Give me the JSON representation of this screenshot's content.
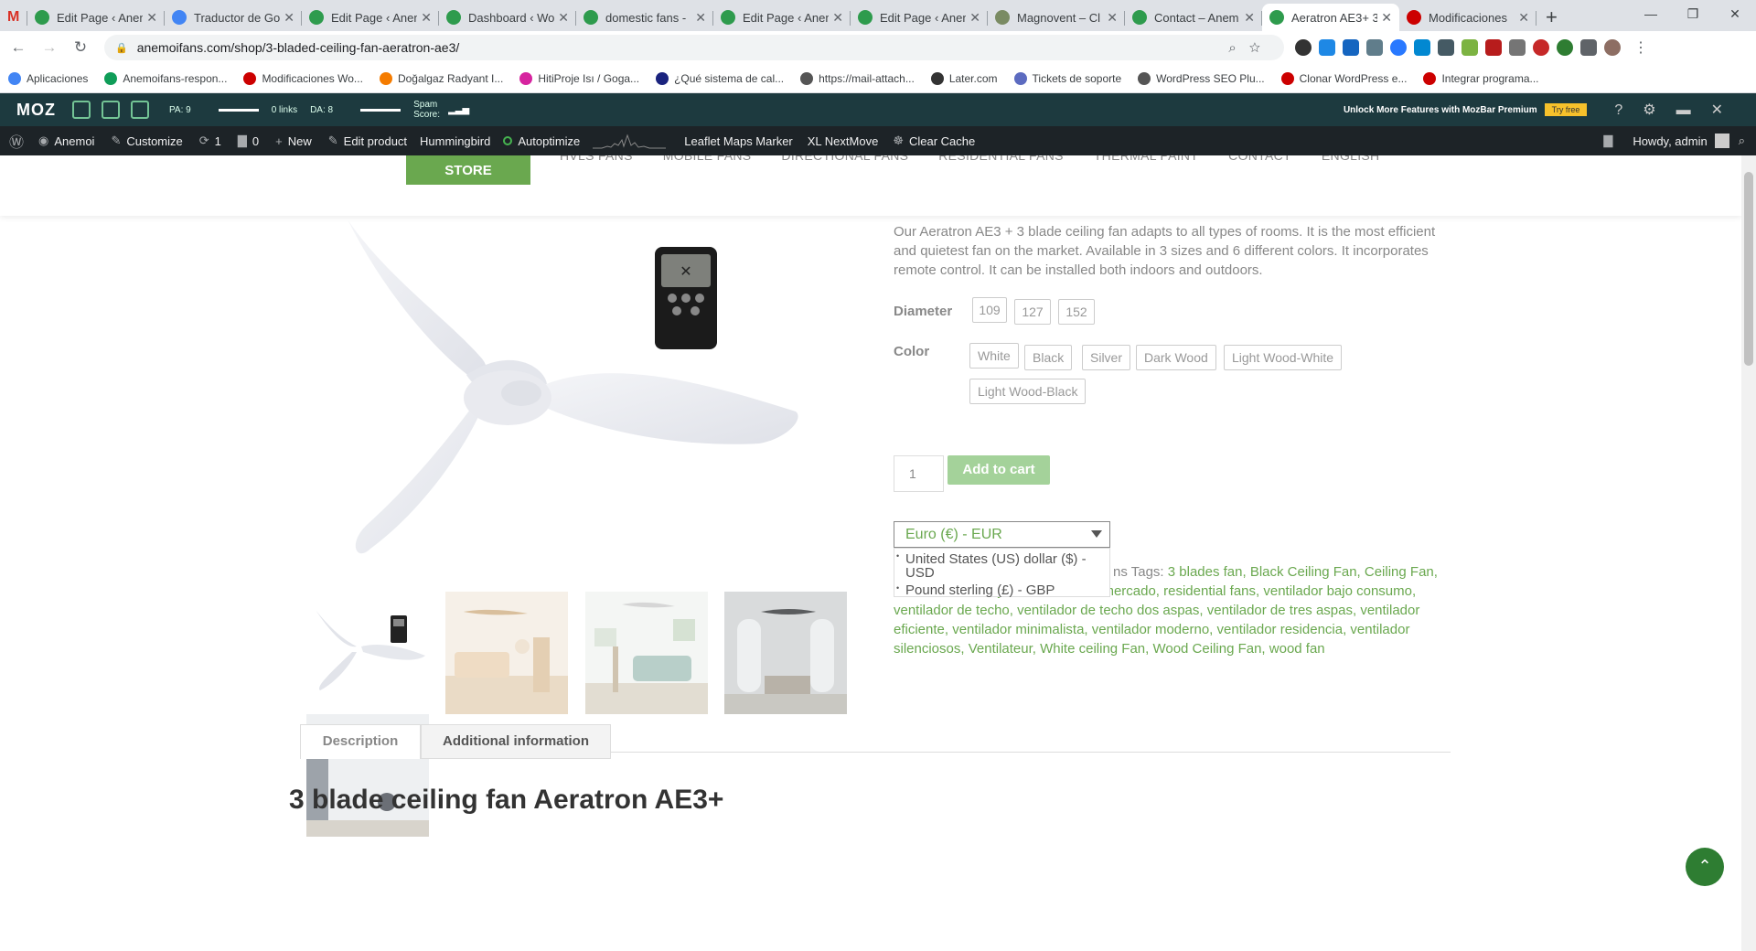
{
  "browser": {
    "tabs": [
      {
        "title": "Edit Page ‹ Anem",
        "fav_color": "#2e9b4d"
      },
      {
        "title": "Traductor de Go",
        "fav_color": "#4285f4"
      },
      {
        "title": "Edit Page ‹ Anem",
        "fav_color": "#2e9b4d"
      },
      {
        "title": "Dashboard ‹ Wo",
        "fav_color": "#2e9b4d"
      },
      {
        "title": "domestic fans -",
        "fav_color": "#2e9b4d"
      },
      {
        "title": "Edit Page ‹ Anem",
        "fav_color": "#2e9b4d"
      },
      {
        "title": "Edit Page ‹ Anem",
        "fav_color": "#2e9b4d"
      },
      {
        "title": "Magnovent – Cl",
        "fav_color": "#7a8b63"
      },
      {
        "title": "Contact – Anem",
        "fav_color": "#2e9b4d"
      },
      {
        "title": "Aeratron AE3+ 3",
        "fav_color": "#2e9b4d"
      },
      {
        "title": "Modificaciones",
        "fav_color": "#c00"
      }
    ],
    "new_tab": "+",
    "url": "anemoifans.com/shop/3-bladed-ceiling-fan-aeratron-ae3/",
    "bookmarks": [
      {
        "label": "Aplicaciones",
        "color": "#4285f4"
      },
      {
        "label": "Anemoifans-respon...",
        "color": "#0f9d58"
      },
      {
        "label": "Modificaciones Wo...",
        "color": "#c00"
      },
      {
        "label": "Doğalgaz Radyant I...",
        "color": "#f57c00"
      },
      {
        "label": "HitiProje Isı / Goga...",
        "color": "#d6249f"
      },
      {
        "label": "¿Qué sistema de cal...",
        "color": "#1a237e"
      },
      {
        "label": "https://mail-attach...",
        "color": "#555"
      },
      {
        "label": "Later.com",
        "color": "#333"
      },
      {
        "label": "Tickets de soporte",
        "color": "#5c6bc0"
      },
      {
        "label": "WordPress SEO Plu...",
        "color": "#555"
      },
      {
        "label": "Clonar WordPress e...",
        "color": "#c00"
      },
      {
        "label": "Integrar programa...",
        "color": "#c00"
      }
    ]
  },
  "mozbar": {
    "logo": "MOZ",
    "pa": "PA: 9",
    "links": "0 links",
    "da": "DA: 8",
    "spam": "Spam Score:",
    "premium": "Unlock More Features with MozBar Premium",
    "try_free": "Try free"
  },
  "wpbar": {
    "site": "Anemoi",
    "customize": "Customize",
    "updates": "1",
    "comments": "0",
    "new": "New",
    "edit_product": "Edit product",
    "hummingbird": "Hummingbird",
    "autoptimize": "Autoptimize",
    "leaflet": "Leaflet Maps Marker",
    "xl": "XL NextMove",
    "clear_cache": "Clear Cache",
    "howdy": "Howdy, admin"
  },
  "site": {
    "store": "STORE",
    "nav": [
      "HVLS FANS",
      "MOBILE FANS",
      "DIRECTIONAL FANS",
      "RESIDENTIAL FANS",
      "THERMAL PAINT",
      "CONTACT",
      "ENGLISH"
    ]
  },
  "product": {
    "description": "Our Aeratron AE3 + 3 blade ceiling fan adapts to all types of rooms. It is the most efficient and quietest fan on the market. Available in 3 sizes and 6 different colors. It incorporates remote control. It can be installed both indoors and outdoors.",
    "diameter_label": "Diameter",
    "diameters": [
      "109",
      "127",
      "152"
    ],
    "color_label": "Color",
    "colors": [
      "White",
      "Black",
      "Silver",
      "Dark Wood",
      "Light Wood-White",
      "Light Wood-Black"
    ],
    "qty": "1",
    "add_to_cart": "Add to cart",
    "currency_selected": "Euro (€) - EUR",
    "currency_options": [
      "United States (US) dollar ($) - USD",
      "Pound sterling (£) - GBP"
    ],
    "tags_label": "ns Tags:",
    "tags_text": "3 blades fan, Black Ceiling Fan, Ceiling Fan, domestic fan, mejor ventilador del mercado, residential fans, ventilador bajo consumo, ventilador de techo, ventilador de techo dos aspas, ventilador de tres aspas, ventilador eficiente, ventilador minimalista, ventilador moderno, ventilador residencia, ventilador silenciosos, Ventilateur, White ceiling Fan, Wood Ceiling Fan, wood fan",
    "tab_description": "Description",
    "tab_additional": "Additional information",
    "bottom_title": "3 blade ceiling fan Aeratron AE3+"
  }
}
